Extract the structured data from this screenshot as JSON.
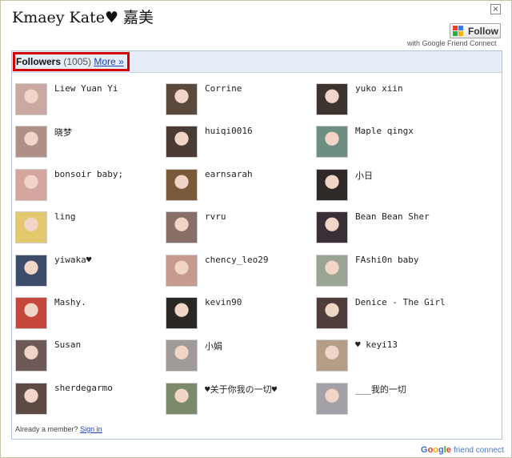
{
  "header": {
    "title": "Kmaey Kate♥ 嘉美",
    "close_label": "×",
    "follow_label": "Follow",
    "with_gfc": "with Google Friend Connect"
  },
  "followers": {
    "label": "Followers",
    "count": "(1005)",
    "more_label": "More »"
  },
  "members": [
    {
      "name": "Liew Yuan Yi",
      "avatar_color": "#caa9a3"
    },
    {
      "name": "Corrine",
      "avatar_color": "#5a4a3e"
    },
    {
      "name": "yuko xiin",
      "avatar_color": "#3d3430"
    },
    {
      "name": "晓梦",
      "avatar_color": "#b08f86"
    },
    {
      "name": "huiqi0016",
      "avatar_color": "#4a3b34"
    },
    {
      "name": "Maple qingx",
      "avatar_color": "#6f8e83"
    },
    {
      "name": "bonsoir baby;",
      "avatar_color": "#d4a59c"
    },
    {
      "name": "earnsarah",
      "avatar_color": "#7a5a3a"
    },
    {
      "name": "小日",
      "avatar_color": "#2f2a28"
    },
    {
      "name": "ling",
      "avatar_color": "#e2c96e"
    },
    {
      "name": "rvru",
      "avatar_color": "#8a6f68"
    },
    {
      "name": "Bean Bean Sher",
      "avatar_color": "#3a2f36"
    },
    {
      "name": "yiwaka♥",
      "avatar_color": "#3b4d6a"
    },
    {
      "name": "chency_leo29",
      "avatar_color": "#c79a8e"
    },
    {
      "name": "FAshi0n baby",
      "avatar_color": "#9aa494"
    },
    {
      "name": "Mashy.",
      "avatar_color": "#c4463d"
    },
    {
      "name": "kevin90",
      "avatar_color": "#2a2624"
    },
    {
      "name": "Denice - The Girl",
      "avatar_color": "#4e3d3a"
    },
    {
      "name": "Susan",
      "avatar_color": "#6d5a56"
    },
    {
      "name": "小娟",
      "avatar_color": "#a09a98"
    },
    {
      "name": "♥ keyi13",
      "avatar_color": "#b69d88"
    },
    {
      "name": "sherdegarmo",
      "avatar_color": "#5e4a44"
    },
    {
      "name": "♥关于你我の一切♥",
      "avatar_color": "#7a8a6a"
    },
    {
      "name": "___我的一切",
      "avatar_color": "#a3a0a8"
    }
  ],
  "footer": {
    "already_text": "Already a member?",
    "sign_in": "Sign in",
    "google_letters": [
      "G",
      "o",
      "o",
      "g",
      "l",
      "e"
    ],
    "friend_connect": "friend connect"
  }
}
